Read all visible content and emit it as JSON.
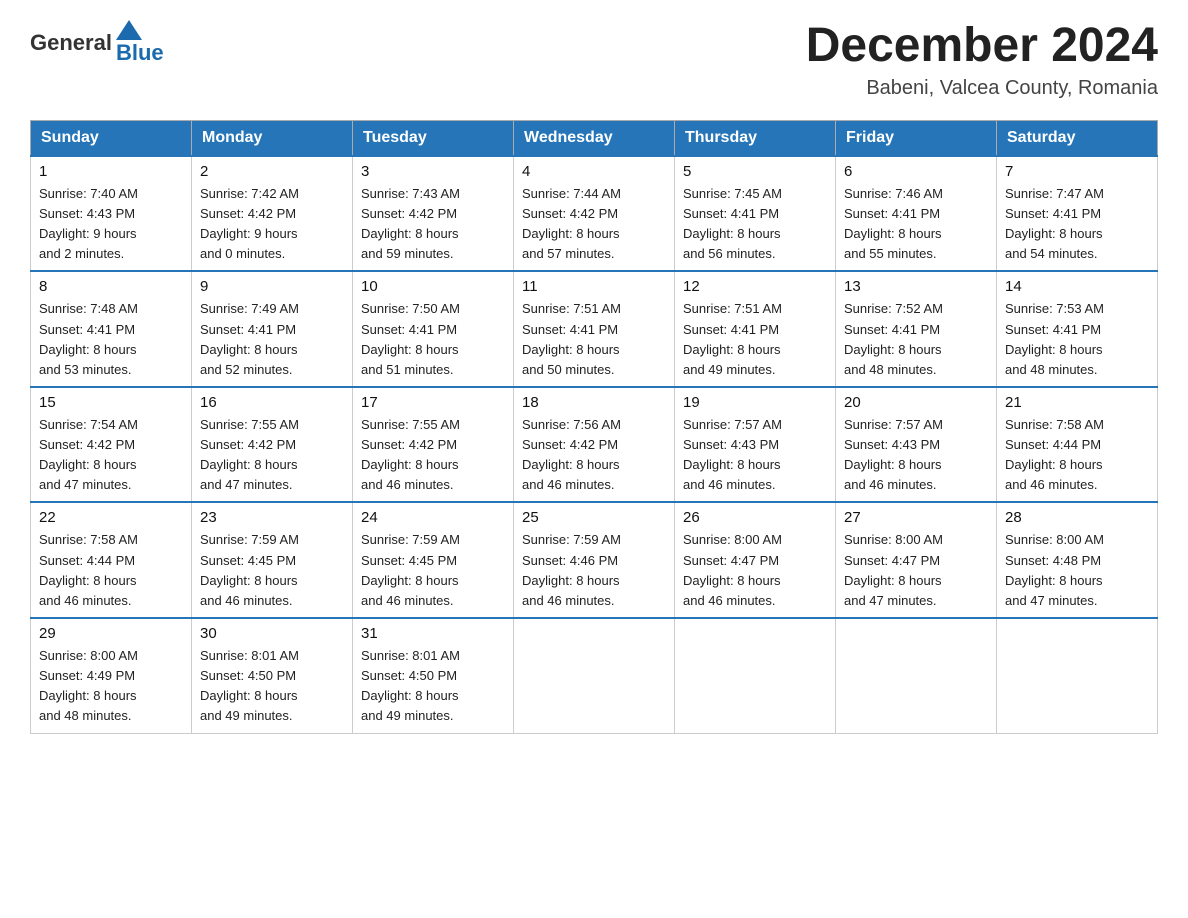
{
  "logo": {
    "general": "General",
    "blue": "Blue",
    "triangle": "▶"
  },
  "title": "December 2024",
  "subtitle": "Babeni, Valcea County, Romania",
  "days_of_week": [
    "Sunday",
    "Monday",
    "Tuesday",
    "Wednesday",
    "Thursday",
    "Friday",
    "Saturday"
  ],
  "weeks": [
    [
      {
        "day": "1",
        "info": "Sunrise: 7:40 AM\nSunset: 4:43 PM\nDaylight: 9 hours\nand 2 minutes."
      },
      {
        "day": "2",
        "info": "Sunrise: 7:42 AM\nSunset: 4:42 PM\nDaylight: 9 hours\nand 0 minutes."
      },
      {
        "day": "3",
        "info": "Sunrise: 7:43 AM\nSunset: 4:42 PM\nDaylight: 8 hours\nand 59 minutes."
      },
      {
        "day": "4",
        "info": "Sunrise: 7:44 AM\nSunset: 4:42 PM\nDaylight: 8 hours\nand 57 minutes."
      },
      {
        "day": "5",
        "info": "Sunrise: 7:45 AM\nSunset: 4:41 PM\nDaylight: 8 hours\nand 56 minutes."
      },
      {
        "day": "6",
        "info": "Sunrise: 7:46 AM\nSunset: 4:41 PM\nDaylight: 8 hours\nand 55 minutes."
      },
      {
        "day": "7",
        "info": "Sunrise: 7:47 AM\nSunset: 4:41 PM\nDaylight: 8 hours\nand 54 minutes."
      }
    ],
    [
      {
        "day": "8",
        "info": "Sunrise: 7:48 AM\nSunset: 4:41 PM\nDaylight: 8 hours\nand 53 minutes."
      },
      {
        "day": "9",
        "info": "Sunrise: 7:49 AM\nSunset: 4:41 PM\nDaylight: 8 hours\nand 52 minutes."
      },
      {
        "day": "10",
        "info": "Sunrise: 7:50 AM\nSunset: 4:41 PM\nDaylight: 8 hours\nand 51 minutes."
      },
      {
        "day": "11",
        "info": "Sunrise: 7:51 AM\nSunset: 4:41 PM\nDaylight: 8 hours\nand 50 minutes."
      },
      {
        "day": "12",
        "info": "Sunrise: 7:51 AM\nSunset: 4:41 PM\nDaylight: 8 hours\nand 49 minutes."
      },
      {
        "day": "13",
        "info": "Sunrise: 7:52 AM\nSunset: 4:41 PM\nDaylight: 8 hours\nand 48 minutes."
      },
      {
        "day": "14",
        "info": "Sunrise: 7:53 AM\nSunset: 4:41 PM\nDaylight: 8 hours\nand 48 minutes."
      }
    ],
    [
      {
        "day": "15",
        "info": "Sunrise: 7:54 AM\nSunset: 4:42 PM\nDaylight: 8 hours\nand 47 minutes."
      },
      {
        "day": "16",
        "info": "Sunrise: 7:55 AM\nSunset: 4:42 PM\nDaylight: 8 hours\nand 47 minutes."
      },
      {
        "day": "17",
        "info": "Sunrise: 7:55 AM\nSunset: 4:42 PM\nDaylight: 8 hours\nand 46 minutes."
      },
      {
        "day": "18",
        "info": "Sunrise: 7:56 AM\nSunset: 4:42 PM\nDaylight: 8 hours\nand 46 minutes."
      },
      {
        "day": "19",
        "info": "Sunrise: 7:57 AM\nSunset: 4:43 PM\nDaylight: 8 hours\nand 46 minutes."
      },
      {
        "day": "20",
        "info": "Sunrise: 7:57 AM\nSunset: 4:43 PM\nDaylight: 8 hours\nand 46 minutes."
      },
      {
        "day": "21",
        "info": "Sunrise: 7:58 AM\nSunset: 4:44 PM\nDaylight: 8 hours\nand 46 minutes."
      }
    ],
    [
      {
        "day": "22",
        "info": "Sunrise: 7:58 AM\nSunset: 4:44 PM\nDaylight: 8 hours\nand 46 minutes."
      },
      {
        "day": "23",
        "info": "Sunrise: 7:59 AM\nSunset: 4:45 PM\nDaylight: 8 hours\nand 46 minutes."
      },
      {
        "day": "24",
        "info": "Sunrise: 7:59 AM\nSunset: 4:45 PM\nDaylight: 8 hours\nand 46 minutes."
      },
      {
        "day": "25",
        "info": "Sunrise: 7:59 AM\nSunset: 4:46 PM\nDaylight: 8 hours\nand 46 minutes."
      },
      {
        "day": "26",
        "info": "Sunrise: 8:00 AM\nSunset: 4:47 PM\nDaylight: 8 hours\nand 46 minutes."
      },
      {
        "day": "27",
        "info": "Sunrise: 8:00 AM\nSunset: 4:47 PM\nDaylight: 8 hours\nand 47 minutes."
      },
      {
        "day": "28",
        "info": "Sunrise: 8:00 AM\nSunset: 4:48 PM\nDaylight: 8 hours\nand 47 minutes."
      }
    ],
    [
      {
        "day": "29",
        "info": "Sunrise: 8:00 AM\nSunset: 4:49 PM\nDaylight: 8 hours\nand 48 minutes."
      },
      {
        "day": "30",
        "info": "Sunrise: 8:01 AM\nSunset: 4:50 PM\nDaylight: 8 hours\nand 49 minutes."
      },
      {
        "day": "31",
        "info": "Sunrise: 8:01 AM\nSunset: 4:50 PM\nDaylight: 8 hours\nand 49 minutes."
      },
      null,
      null,
      null,
      null
    ]
  ]
}
